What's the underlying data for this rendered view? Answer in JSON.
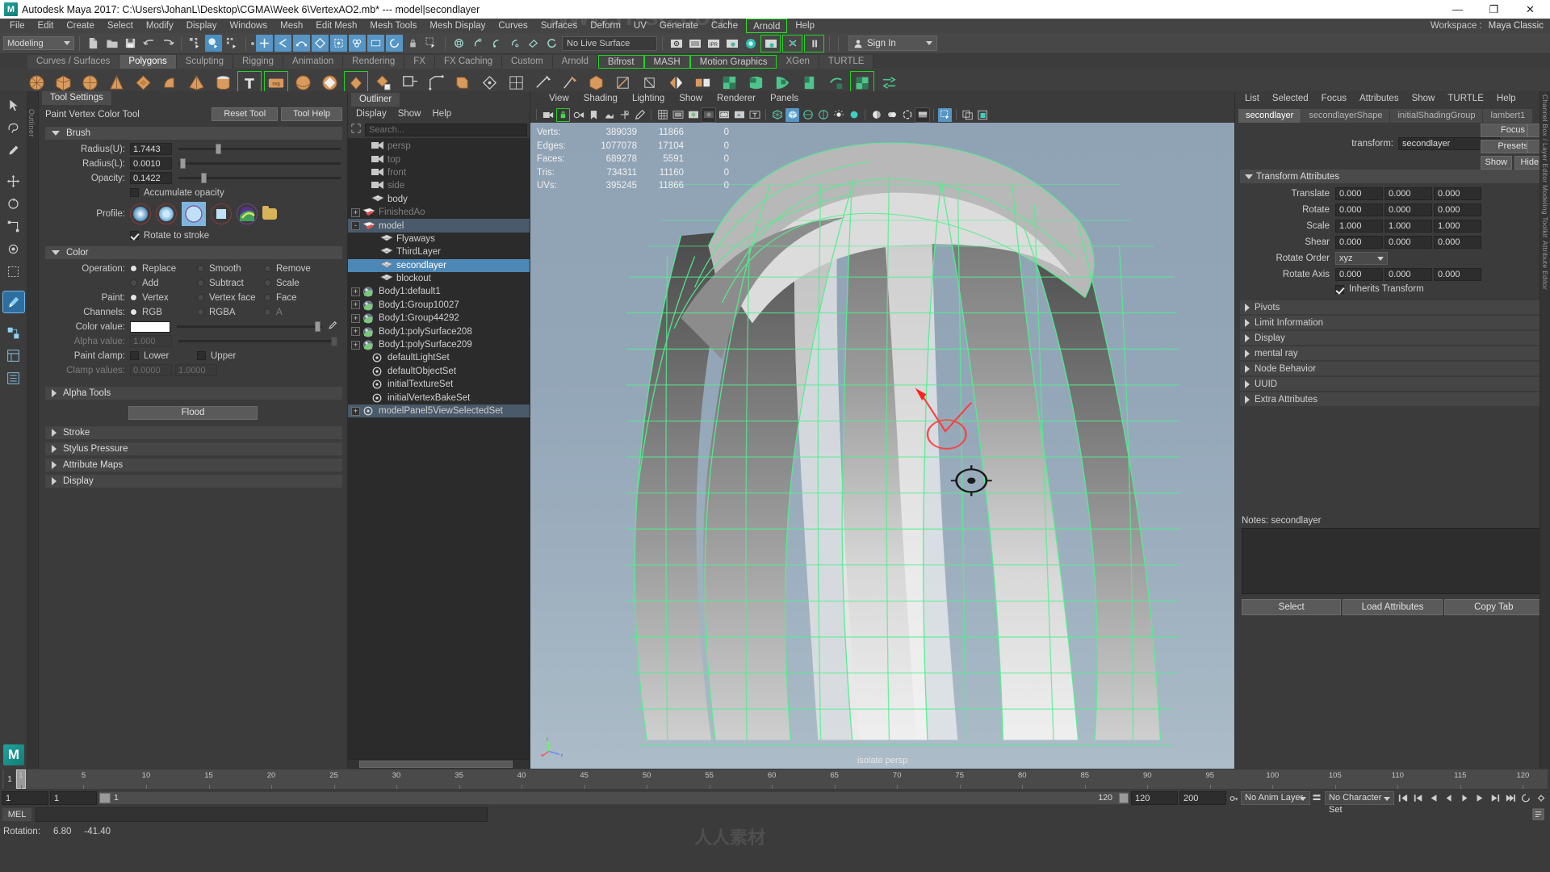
{
  "titlebar": {
    "app_title": "Autodesk Maya 2017: C:\\Users\\JohanL\\Desktop\\CGMA\\Week 6\\VertexAO2.mb*  ---  model|secondlayer",
    "logo": "M",
    "minimize": "—",
    "maximize": "❐",
    "close": "✕"
  },
  "menubar": {
    "items": [
      "File",
      "Edit",
      "Create",
      "Select",
      "Modify",
      "Display",
      "Windows",
      "Mesh",
      "Edit Mesh",
      "Mesh Tools",
      "Mesh Display",
      "Curves",
      "Surfaces",
      "Deform",
      "UV",
      "Generate",
      "Cache"
    ],
    "highlighted": "Arnold",
    "help": "Help",
    "workspace_label": "Workspace :",
    "workspace_value": "Maya Classic"
  },
  "statusbar": {
    "menuset": "Modeling",
    "live_surface": "No Live Surface",
    "signin": "Sign In",
    "icons": [
      "new-scene-icon",
      "open-scene-icon",
      "save-scene-icon",
      "undo-icon",
      "redo-icon",
      "select-hierarchy-icon",
      "select-object-icon",
      "select-component-icon",
      "snap-grid-icon",
      "snap-curve-icon",
      "snap-point-icon",
      "snap-view-icon",
      "snap-projected-icon",
      "make-live-icon",
      "render-view-icon",
      "render-frame-icon",
      "ipr-render-icon",
      "render-settings-icon",
      "hypershade-icon",
      "render-setup-icon",
      "light-editor-icon",
      "pause-render-icon"
    ]
  },
  "shelf": {
    "tabs": [
      "Curves / Surfaces",
      "Polygons",
      "Sculpting",
      "Rigging",
      "Animation",
      "Rendering",
      "FX",
      "FX Caching",
      "Custom",
      "Arnold",
      "Bifrost",
      "MASH",
      "Motion Graphics",
      "XGen",
      "TURTLE"
    ],
    "active_tab": "Polygons",
    "green_tabs": [
      "Bifrost",
      "MASH",
      "Motion Graphics"
    ]
  },
  "toolbox": {
    "items": [
      "select-tool",
      "lasso-select-tool",
      "paint-select-tool",
      "move-tool",
      "rotate-tool",
      "scale-tool",
      "soft-modification-tool",
      "last-tool-used",
      "paint-vertex-color-tool",
      "show-manipulator-tool",
      "hypergraph-tool",
      "outliner-tool"
    ],
    "selected": "paint-vertex-color-tool"
  },
  "tool_settings": {
    "panel_tab": "Tool Settings",
    "vertical_tab": "Outliner",
    "tool_name": "Paint Vertex Color Tool",
    "reset_button": "Reset Tool",
    "help_button": "Tool Help",
    "brush": {
      "frame_label": "Brush",
      "radius_u_label": "Radius(U):",
      "radius_u_value": "1.7443",
      "radius_u_pct": 23,
      "radius_l_label": "Radius(L):",
      "radius_l_value": "0.0010",
      "radius_l_pct": 2,
      "opacity_label": "Opacity:",
      "opacity_value": "0.1422",
      "opacity_pct": 14,
      "accumulate_label": "Accumulate opacity",
      "accumulate_checked": false,
      "profile_label": "Profile:",
      "profile_selected_index": 2,
      "rotate_label": "Rotate to stroke",
      "rotate_checked": true
    },
    "color": {
      "frame_label": "Color",
      "operation_label": "Operation:",
      "operation_options": [
        "Replace",
        "Smooth",
        "Remove",
        "Add",
        "Subtract",
        "Scale"
      ],
      "operation_selected": "Replace",
      "paint_label": "Paint:",
      "paint_options": [
        "Vertex",
        "Vertex face",
        "Face"
      ],
      "paint_selected": "Vertex",
      "channels_label": "Channels:",
      "channels_options": [
        "RGB",
        "RGBA",
        "A"
      ],
      "channels_selected": "RGB",
      "color_value_label": "Color value:",
      "color_value_hex": "#ffffff",
      "color_value_pct": 96,
      "alpha_value_label": "Alpha value:",
      "alpha_value": "1.000",
      "paint_clamp_label": "Paint clamp:",
      "clamp_lower_label": "Lower",
      "clamp_upper_label": "Upper",
      "clamp_values_label": "Clamp values:",
      "clamp_lower_value": "0.0000",
      "clamp_upper_value": "1.0000"
    },
    "sections": [
      "Alpha Tools",
      "Stroke",
      "Stylus Pressure",
      "Attribute Maps",
      "Display"
    ],
    "flood_button": "Flood"
  },
  "outliner": {
    "panel_tab": "Outliner",
    "menu": [
      "Display",
      "Show",
      "Help"
    ],
    "search_placeholder": "Search...",
    "items": [
      {
        "label": "persp",
        "icon": "camera-icon",
        "indent": 1,
        "expand": "",
        "dim": true,
        "state": ""
      },
      {
        "label": "top",
        "icon": "camera-icon",
        "indent": 1,
        "expand": "",
        "dim": true,
        "state": ""
      },
      {
        "label": "front",
        "icon": "camera-icon",
        "indent": 1,
        "expand": "",
        "dim": true,
        "state": ""
      },
      {
        "label": "side",
        "icon": "camera-icon",
        "indent": 1,
        "expand": "",
        "dim": true,
        "state": ""
      },
      {
        "label": "body",
        "icon": "mesh-icon",
        "indent": 1,
        "expand": "",
        "dim": false,
        "state": ""
      },
      {
        "label": "FinishedAo",
        "icon": "layer-icon",
        "indent": 0,
        "expand": "+",
        "dim": true,
        "state": ""
      },
      {
        "label": "model",
        "icon": "layer-icon",
        "indent": 0,
        "expand": "-",
        "dim": false,
        "state": "sel2"
      },
      {
        "label": "Flyaways",
        "icon": "mesh-icon",
        "indent": 2,
        "expand": "",
        "dim": false,
        "state": ""
      },
      {
        "label": "ThirdLayer",
        "icon": "mesh-icon",
        "indent": 2,
        "expand": "",
        "dim": false,
        "state": ""
      },
      {
        "label": "secondlayer",
        "icon": "mesh-icon",
        "indent": 2,
        "expand": "",
        "dim": false,
        "state": "sel"
      },
      {
        "label": "blockout",
        "icon": "mesh-icon",
        "indent": 2,
        "expand": "",
        "dim": false,
        "state": ""
      },
      {
        "label": "Body1:default1",
        "icon": "shader-icon",
        "indent": 0,
        "expand": "+",
        "dim": false,
        "state": ""
      },
      {
        "label": "Body1:Group10027",
        "icon": "shader-icon",
        "indent": 0,
        "expand": "+",
        "dim": false,
        "state": ""
      },
      {
        "label": "Body1:Group44292",
        "icon": "shader-icon",
        "indent": 0,
        "expand": "+",
        "dim": false,
        "state": ""
      },
      {
        "label": "Body1:polySurface208",
        "icon": "shader-icon",
        "indent": 0,
        "expand": "+",
        "dim": false,
        "state": ""
      },
      {
        "label": "Body1:polySurface209",
        "icon": "shader-icon",
        "indent": 0,
        "expand": "+",
        "dim": false,
        "state": ""
      },
      {
        "label": "defaultLightSet",
        "icon": "set-icon",
        "indent": 1,
        "expand": "",
        "dim": false,
        "state": ""
      },
      {
        "label": "defaultObjectSet",
        "icon": "set-icon",
        "indent": 1,
        "expand": "",
        "dim": false,
        "state": ""
      },
      {
        "label": "initialTextureSet",
        "icon": "set-icon",
        "indent": 1,
        "expand": "",
        "dim": false,
        "state": ""
      },
      {
        "label": "initialVertexBakeSet",
        "icon": "set-icon",
        "indent": 1,
        "expand": "",
        "dim": false,
        "state": ""
      },
      {
        "label": "modelPanel5ViewSelectedSet",
        "icon": "set-icon",
        "indent": 0,
        "expand": "+",
        "dim": false,
        "state": "sel2"
      }
    ]
  },
  "viewport": {
    "menu": [
      "View",
      "Shading",
      "Lighting",
      "Show",
      "Renderer",
      "Panels"
    ],
    "camera_label": "isolate  persp",
    "hud": {
      "rows": [
        {
          "label": "Verts:",
          "total": "389039",
          "selected": "11866",
          "extra": "0"
        },
        {
          "label": "Edges:",
          "total": "1077078",
          "selected": "17104",
          "extra": "0"
        },
        {
          "label": "Faces:",
          "total": "689278",
          "selected": "5591",
          "extra": "0"
        },
        {
          "label": "Tris:",
          "total": "734311",
          "selected": "11160",
          "extra": "0"
        },
        {
          "label": "UVs:",
          "total": "395245",
          "selected": "11866",
          "extra": "0"
        }
      ]
    },
    "axis_labels": {
      "x": "x",
      "y": "y",
      "z": "z"
    },
    "toolbar_icons": [
      "select-camera-icon",
      "lock-camera-icon",
      "camera-attributes-icon",
      "bookmark-icon",
      "image-plane-icon",
      "two-d-pan-zoom-icon",
      "grease-pencil-icon",
      "grid-icon",
      "film-gate-icon",
      "resolution-gate-icon",
      "gate-mask-icon",
      "film-origin-icon",
      "safe-action-icon",
      "safe-title-icon",
      "wireframe-icon",
      "smooth-shade-icon",
      "shaded-wireframe-icon",
      "textured-icon",
      "lighting-icon",
      "shadows-icon",
      "ao-icon",
      "motion-blur-icon",
      "aa-icon",
      "xray-icon",
      "isolate-select-icon",
      "panel-layout-icon",
      "copy-panel-icon"
    ]
  },
  "attribute_editor": {
    "menu": [
      "List",
      "Selected",
      "Focus",
      "Attributes",
      "Show",
      "TURTLE",
      "Help"
    ],
    "tabs": [
      "secondlayer",
      "secondlayerShape",
      "initialShadingGroup",
      "lambert1"
    ],
    "active_tab": "secondlayer",
    "node_label": "transform:",
    "node_value": "secondlayer",
    "right_buttons": [
      "Focus",
      "Presets"
    ],
    "show_button": "Show",
    "hide_button": "Hide",
    "transform_frame": "Transform Attributes",
    "attributes": [
      {
        "label": "Translate",
        "values": [
          "0.000",
          "0.000",
          "0.000"
        ]
      },
      {
        "label": "Rotate",
        "values": [
          "0.000",
          "0.000",
          "0.000"
        ]
      },
      {
        "label": "Scale",
        "values": [
          "1.000",
          "1.000",
          "1.000"
        ]
      },
      {
        "label": "Shear",
        "values": [
          "0.000",
          "0.000",
          "0.000"
        ]
      }
    ],
    "rotate_order_label": "Rotate Order",
    "rotate_order_value": "xyz",
    "rotate_axis_label": "Rotate Axis",
    "rotate_axis_values": [
      "0.000",
      "0.000",
      "0.000"
    ],
    "inherits_label": "Inherits Transform",
    "inherits_checked": true,
    "collapsed_sections": [
      "Pivots",
      "Limit Information",
      "Display",
      "mental ray",
      "Node Behavior",
      "UUID",
      "Extra Attributes"
    ],
    "notes_label": "Notes:",
    "notes_value": "secondlayer",
    "bottom_buttons": [
      "Select",
      "Load Attributes",
      "Copy Tab"
    ],
    "vertical_tabs": [
      "Channel Box / Layer Editor",
      "Modeling Toolkit",
      "Attribute Editor"
    ]
  },
  "timeline": {
    "ticks": [
      "1",
      "5",
      "10",
      "15",
      "20",
      "25",
      "30",
      "35",
      "40",
      "45",
      "50",
      "55",
      "60",
      "65",
      "70",
      "75",
      "80",
      "85",
      "90",
      "95",
      "100",
      "105",
      "110",
      "115",
      "120"
    ],
    "current_frame_label": "1",
    "current_frame_field": "1",
    "frame_field_2": "1",
    "range_start": "1",
    "range_end": "120",
    "playback_start": "120",
    "playback_end": "200",
    "anim_layer": "No Anim Layer",
    "character_set": "No Character Set",
    "mel_label": "MEL",
    "status_label": "Rotation:",
    "status_value_1": "6.80",
    "status_value_2": "-41.40"
  }
}
